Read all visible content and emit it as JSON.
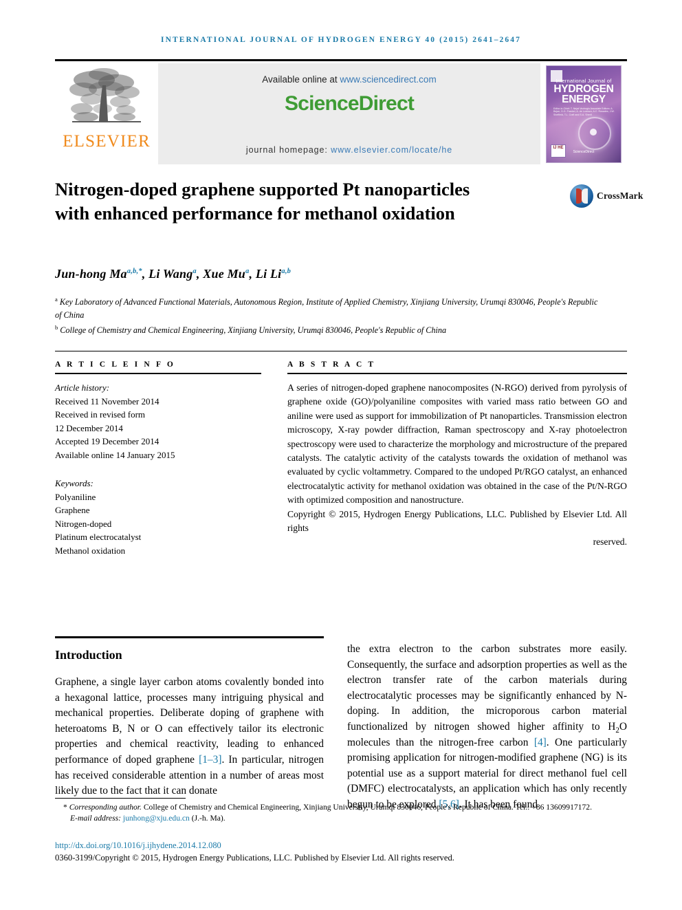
{
  "running_head": "International Journal of Hydrogen Energy 40 (2015) 2641–2647",
  "masthead": {
    "publisher_name": "ELSEVIER",
    "available_prefix": "Available online at ",
    "available_url": "www.sciencedirect.com",
    "brand_part1": "Science",
    "brand_part2": "Direct",
    "homepage_label": "journal homepage: ",
    "homepage_url": "www.elsevier.com/locate/he",
    "cover": {
      "line_small": "International Journal of",
      "line_big1": "HYDROGEN",
      "line_big2": "ENERGY",
      "editors": "Editor-in-Chief:  T. Nejat Veziroglu\nAssociate Editors:  A. Bejan, D.G. Frankel, A. de Lorenzo,\nA.C. Rosades, J.W. Sheffield,\nT.L. Craft  and  S.A. Sherif",
      "badge": "IJ\nHE",
      "sd_mark": "ScienceDirect"
    }
  },
  "article": {
    "title": "Nitrogen-doped graphene supported Pt nanoparticles with enhanced performance for methanol oxidation",
    "crossmark_label": "CrossMark",
    "authors": [
      {
        "name": "Jun-hong Ma",
        "sup": "a,b,*"
      },
      {
        "name": "Li Wang",
        "sup": "a"
      },
      {
        "name": "Xue Mu",
        "sup": "a"
      },
      {
        "name": "Li Li",
        "sup": "a,b"
      }
    ],
    "affiliations": [
      {
        "marker": "a",
        "text": "Key Laboratory of Advanced Functional Materials, Autonomous Region, Institute of Applied Chemistry, Xinjiang University, Urumqi 830046, People's Republic of China"
      },
      {
        "marker": "b",
        "text": "College of Chemistry and Chemical Engineering, Xinjiang University, Urumqi 830046, People's Republic of China"
      }
    ]
  },
  "info": {
    "heading": "A R T I C L E   I N F O",
    "history_label": "Article history:",
    "history": [
      "Received 11 November 2014",
      "Received in revised form",
      "12 December 2014",
      "Accepted 19 December 2014",
      "Available online 14 January 2015"
    ],
    "keywords_label": "Keywords:",
    "keywords": [
      "Polyaniline",
      "Graphene",
      "Nitrogen-doped",
      "Platinum electrocatalyst",
      "Methanol oxidation"
    ]
  },
  "abstract": {
    "heading": "A B S T R A C T",
    "body": "A series of nitrogen-doped graphene nanocomposites (N-RGO) derived from pyrolysis of graphene oxide (GO)/polyaniline composites with varied mass ratio between GO and aniline were used as support for immobilization of Pt nanoparticles. Transmission electron microscopy, X-ray powder diffraction, Raman spectroscopy and X-ray photoelectron spectroscopy were used to characterize the morphology and microstructure of the prepared catalysts. The catalytic activity of the catalysts towards the oxidation of methanol was evaluated by cyclic voltammetry. Compared to the undoped Pt/RGO catalyst, an enhanced electrocatalytic activity for methanol oxidation was obtained in the case of the Pt/N-RGO with optimized composition and nanostructure.",
    "copyright_main": "Copyright © 2015, Hydrogen Energy Publications, LLC. Published by Elsevier Ltd. All rights",
    "copyright_tail": "reserved."
  },
  "body": {
    "intro_heading": "Introduction",
    "left_paragraph_a": "Graphene, a single layer carbon atoms covalently bonded into a hexagonal lattice, processes many intriguing physical and mechanical properties. Deliberate doping of graphene with heteroatoms B, N or O can effectively tailor its electronic properties and chemical reactivity, leading to enhanced performance of doped graphene ",
    "left_ref_1": "[1–3]",
    "left_paragraph_b": ". In particular, nitrogen has received considerable attention in a number of areas most likely due to the fact that it can donate",
    "right_paragraph_a": "the extra electron to the carbon substrates more easily. Consequently, the surface and adsorption properties as well as the electron transfer rate of the carbon materials during electrocatalytic processes may be significantly enhanced by N-doping. In addition, the microporous carbon material functionalized by nitrogen showed higher affinity to H",
    "right_sub_2": "2",
    "right_paragraph_b": "O molecules than the nitrogen-free carbon ",
    "right_ref_4": "[4]",
    "right_paragraph_c": ". One particularly promising application for nitrogen-modified graphene (NG) is its potential use as a support material for direct methanol fuel cell (DMFC) electrocatalysts, an application which has only recently begun to be explored ",
    "right_ref_56": "[5,6]",
    "right_paragraph_d": ". It has been found"
  },
  "footer": {
    "corresponding_marker": "*",
    "corresponding_label": "Corresponding author.",
    "corresponding_text": " College of Chemistry and Chemical Engineering, Xinjiang University, Urumqi 830046, People's Republic of China. Tel.: +86 13609917172.",
    "email_label": "E-mail address: ",
    "email": "junhong@xju.edu.cn",
    "email_suffix": " (J.-h. Ma).",
    "doi": "http://dx.doi.org/10.1016/j.ijhydene.2014.12.080",
    "issn_line": "0360-3199/Copyright © 2015, Hydrogen Energy Publications, LLC. Published by Elsevier Ltd. All rights reserved."
  },
  "colors": {
    "link_blue": "#1a7aa8",
    "sciencedirect_green": "#3f9c35",
    "elsevier_orange": "#f08a1c",
    "masthead_grey": "#ececec"
  }
}
